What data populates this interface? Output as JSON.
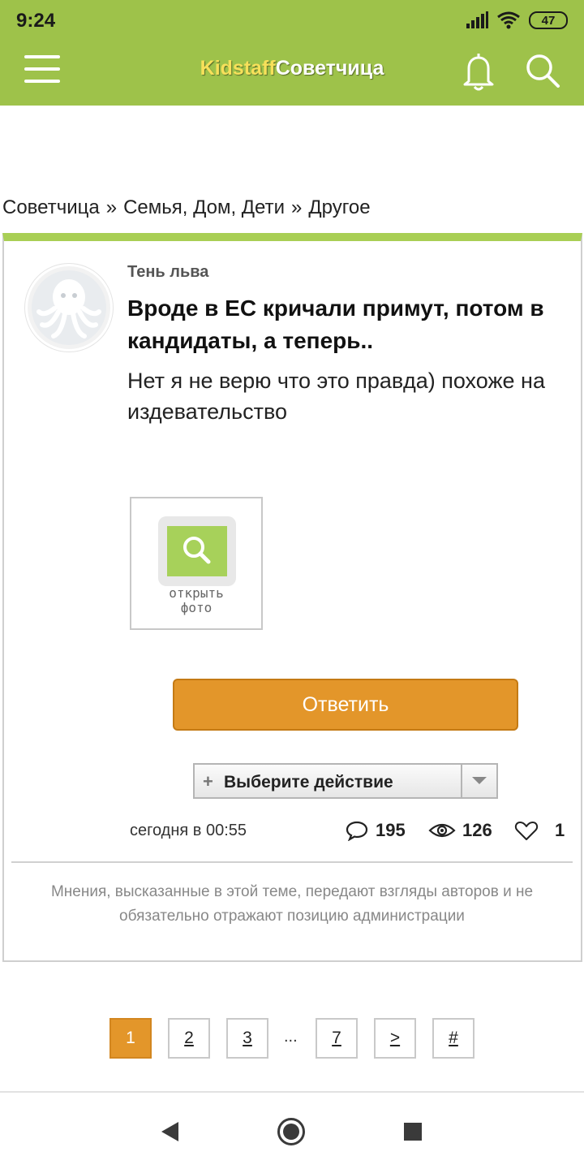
{
  "status_bar": {
    "time": "9:24",
    "battery": "47"
  },
  "header": {
    "logo_part1": "Kidstaff",
    "logo_part2": "Советчица",
    "menu_icon": "hamburger-icon",
    "bell_icon": "bell-icon",
    "search_icon": "search-icon",
    "accent_color": "#9ec24a"
  },
  "breadcrumb": {
    "items": [
      "Советчица",
      "Семья, Дом, Дети",
      "Другое"
    ],
    "separator": "»"
  },
  "post": {
    "author": "Тень льва",
    "title": "Вроде в ЕС кричали примут, потом в кандидаты, а теперь..",
    "body": "Нет я не верю что это правда) похоже на издевательство",
    "photo_label_line1": "открыть",
    "photo_label_line2": "фото",
    "reply_label": "Ответить",
    "action_label": "Выберите действие",
    "date": "сегодня в 00:55",
    "comments": "195",
    "views": "126",
    "likes": "1",
    "disclaimer": "Мнения, высказанные в этой теме, передают взгляды авторов и не обязательно отражают позицию администрации"
  },
  "pagination": {
    "pages": [
      "1",
      "2",
      "3",
      "7"
    ],
    "ellipsis": "...",
    "next": ">",
    "last": "#",
    "current": "1"
  }
}
